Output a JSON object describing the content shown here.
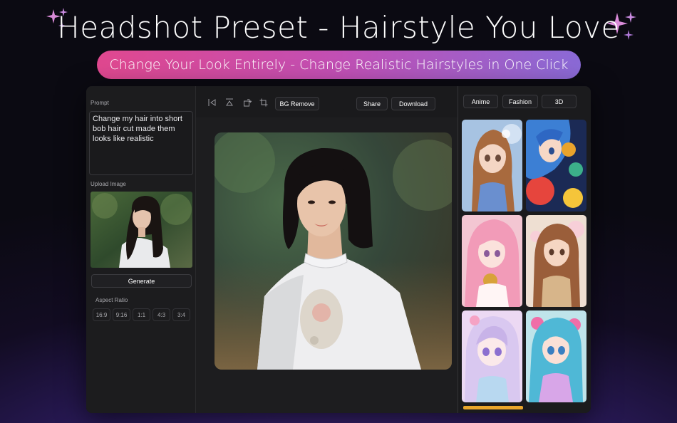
{
  "header": {
    "title": "Headshot Preset - Hairstyle You Love",
    "subtitle": "Change Your Look Entirely - Change Realistic Hairstyles in One Click"
  },
  "left_panel": {
    "prompt_label": "Prompt",
    "prompt_value": "Change my hair into short bob hair cut made them looks like realistic",
    "upload_label": "Upload Image",
    "generate_label": "Generate",
    "aspect_label": "Aspect Ratio",
    "aspect_ratios": [
      "16:9",
      "9:16",
      "1:1",
      "4:3",
      "3:4"
    ]
  },
  "toolbar": {
    "icons": [
      "align-left-icon",
      "align-top-icon",
      "rotate-icon",
      "crop-icon"
    ],
    "bg_remove_label": "BG Remove",
    "share_label": "Share",
    "download_label": "Download"
  },
  "right_panel": {
    "categories": [
      "Anime",
      "Fashion",
      "3D"
    ]
  },
  "colors": {
    "accent_pink": "#e0488f",
    "accent_purple": "#8a6ad6",
    "window_bg": "#1b1b1d",
    "progress_bar": "#e9a62c"
  }
}
